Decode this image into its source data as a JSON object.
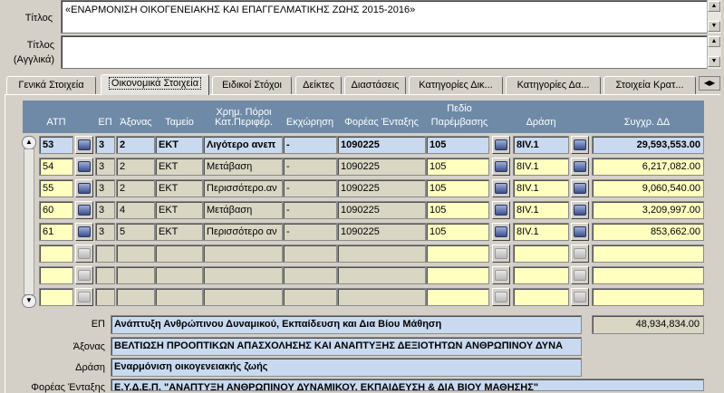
{
  "form": {
    "title_label": "Τίτλος",
    "title_value": "«ΕΝΑΡΜΟΝΙΣΗ ΟΙΚΟΓΕΝΕΙΑΚΗΣ ΚΑΙ ΕΠΑΓΓΕΛΜΑΤΙΚΗΣ ΖΩΗΣ 2015-2016»",
    "title_en_label_1": "Τίτλος",
    "title_en_label_2": "(Αγγλικά)",
    "title_en_value": ""
  },
  "tabs": [
    {
      "label": "Γενικά Στοιχεία",
      "active": false
    },
    {
      "label": "Οικονομικά Στοιχεία",
      "active": true
    },
    {
      "label": "Ειδικοί Στόχοι",
      "active": false
    },
    {
      "label": "Δείκτες",
      "active": false
    },
    {
      "label": "Διαστάσεις",
      "active": false
    },
    {
      "label": "Κατηγορίες Δικ...",
      "active": false
    },
    {
      "label": "Κατηγορίες Δα...",
      "active": false
    },
    {
      "label": "Στοιχεία Κρατ...",
      "active": false
    }
  ],
  "grid": {
    "headers": {
      "atp": "ΑΤΠ",
      "ep": "ΕΠ",
      "axonas": "Άξονας",
      "tameio": "Ταμείο",
      "xrim_group": "Χρημ. Πόροι",
      "kat_perif": "Κατ.Περιφέρ.",
      "ekxorisi": "Εκχώρηση",
      "foreas": "Φορέας Ένταξης",
      "pedio_1": "Πεδίο",
      "pedio_2": "Παρέμβασης",
      "drasi": "Δράση",
      "sygxr": "Συγχρ. ΔΔ"
    },
    "rows": [
      {
        "atp": "53",
        "ep": "3",
        "axonas": "2",
        "tameio": "ΕΚΤ",
        "kat_perif": "Λιγότερο ανεπ",
        "ekxorisi": "-",
        "foreas": "1090225",
        "pedio": "105",
        "drasi": "8IV.1",
        "sygxr": "29,593,553.00"
      },
      {
        "atp": "54",
        "ep": "3",
        "axonas": "2",
        "tameio": "ΕΚΤ",
        "kat_perif": "Μετάβαση",
        "ekxorisi": "-",
        "foreas": "1090225",
        "pedio": "105",
        "drasi": "8IV.1",
        "sygxr": "6,217,082.00"
      },
      {
        "atp": "55",
        "ep": "3",
        "axonas": "2",
        "tameio": "ΕΚΤ",
        "kat_perif": "Περισσότερο.αν",
        "ekxorisi": "-",
        "foreas": "1090225",
        "pedio": "105",
        "drasi": "8IV.1",
        "sygxr": "9,060,540.00"
      },
      {
        "atp": "60",
        "ep": "3",
        "axonas": "4",
        "tameio": "ΕΚΤ",
        "kat_perif": "Μετάβαση",
        "ekxorisi": "-",
        "foreas": "1090225",
        "pedio": "105",
        "drasi": "8IV.1",
        "sygxr": "3,209,997.00"
      },
      {
        "atp": "61",
        "ep": "3",
        "axonas": "5",
        "tameio": "ΕΚΤ",
        "kat_perif": "Περισσότερο αν",
        "ekxorisi": "-",
        "foreas": "1090225",
        "pedio": "105",
        "drasi": "8IV.1",
        "sygxr": "853,662.00"
      },
      {
        "atp": "",
        "ep": "",
        "axonas": "",
        "tameio": "",
        "kat_perif": "",
        "ekxorisi": "",
        "foreas": "",
        "pedio": "",
        "drasi": "",
        "sygxr": ""
      },
      {
        "atp": "",
        "ep": "",
        "axonas": "",
        "tameio": "",
        "kat_perif": "",
        "ekxorisi": "",
        "foreas": "",
        "pedio": "",
        "drasi": "",
        "sygxr": ""
      },
      {
        "atp": "",
        "ep": "",
        "axonas": "",
        "tameio": "",
        "kat_perif": "",
        "ekxorisi": "",
        "foreas": "",
        "pedio": "",
        "drasi": "",
        "sygxr": ""
      }
    ]
  },
  "details": {
    "ep_label": "ΕΠ",
    "ep_value": "Ανάπτυξη Ανθρώπινου Δυναμικού, Εκπαίδευση και Δια Βίου Μάθηση",
    "total_value": "48,934,834.00",
    "axonas_label": "Άξονας",
    "axonas_value": "ΒΕΛΤΙΩΣΗ ΠΡΟΟΠΤΙΚΩΝ ΑΠΑΣΧΟΛΗΣΗΣ ΚΑΙ ΑΝΑΠΤΥΞΗΣ ΔΕΞΙΟΤΗΤΩΝ ΑΝΘΡΩΠΙΝΟΥ ΔΥΝΑ",
    "drasi_label": "Δράση",
    "drasi_value": "Εναρμόνιση οικογενειακής ζωής",
    "foreas_label": "Φορέας Ένταξης",
    "foreas_value": "Ε.Υ.Δ.Ε.Π. \"ΑΝΑΠΤΥΞΗ ΑΝΘΡΩΠΙΝΟΥ ΔΥΝΑΜΙΚΟΥ, ΕΚΠΑΙΔΕΥΣΗ & ΔΙΑ ΒΙΟΥ ΜΑΘΗΣΗΣ\""
  },
  "colors": {
    "grid_header": "#6e8aa6",
    "editable_cell": "#ffffc0",
    "readonly_cell": "#d9d6c4",
    "selected_cell": "#c9daf0"
  }
}
